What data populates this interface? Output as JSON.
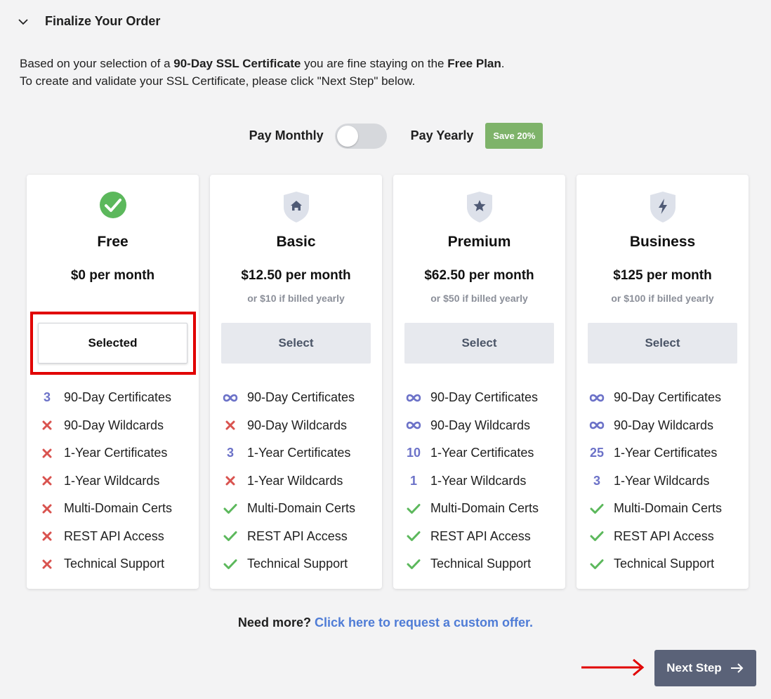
{
  "section": {
    "title": "Finalize Your Order",
    "collapse_icon": "chevron-down-icon"
  },
  "intro": {
    "line1_prefix": "Based on your selection of a ",
    "line1_cert": "90-Day SSL Certificate",
    "line1_mid": " you are fine staying on the ",
    "line1_plan": "Free Plan",
    "line1_suffix": ".",
    "line2": "To create and validate your SSL Certificate, please click \"Next Step\" below."
  },
  "billing": {
    "monthly_label": "Pay Monthly",
    "yearly_label": "Pay Yearly",
    "save_badge": "Save 20%",
    "toggle_state": "monthly"
  },
  "colors": {
    "check": "#5cb85c",
    "cross": "#d9534f",
    "count": "#6c72c8",
    "shield": "#dde1ea",
    "shield_glyph": "#4f5a75",
    "highlight": "#e10000",
    "link": "#4f7cd6",
    "next_button": "#5a6278"
  },
  "plans": [
    {
      "name": "Free",
      "price": "$0 per month",
      "yearly_note": "",
      "button": "Selected",
      "state": "selected",
      "icon": "check-circle-icon",
      "features": [
        {
          "mark": "count",
          "value": "3",
          "label": "90-Day Certificates"
        },
        {
          "mark": "cross",
          "value": "",
          "label": "90-Day Wildcards"
        },
        {
          "mark": "cross",
          "value": "",
          "label": "1-Year Certificates"
        },
        {
          "mark": "cross",
          "value": "",
          "label": "1-Year Wildcards"
        },
        {
          "mark": "cross",
          "value": "",
          "label": "Multi-Domain Certs"
        },
        {
          "mark": "cross",
          "value": "",
          "label": "REST API Access"
        },
        {
          "mark": "cross",
          "value": "",
          "label": "Technical Support"
        }
      ]
    },
    {
      "name": "Basic",
      "price": "$12.50 per month",
      "yearly_note": "or $10 if billed yearly",
      "button": "Select",
      "state": "select",
      "icon": "shield-home-icon",
      "features": [
        {
          "mark": "infinity",
          "value": "",
          "label": "90-Day Certificates"
        },
        {
          "mark": "cross",
          "value": "",
          "label": "90-Day Wildcards"
        },
        {
          "mark": "count",
          "value": "3",
          "label": "1-Year Certificates"
        },
        {
          "mark": "cross",
          "value": "",
          "label": "1-Year Wildcards"
        },
        {
          "mark": "check",
          "value": "",
          "label": "Multi-Domain Certs"
        },
        {
          "mark": "check",
          "value": "",
          "label": "REST API Access"
        },
        {
          "mark": "check",
          "value": "",
          "label": "Technical Support"
        }
      ]
    },
    {
      "name": "Premium",
      "price": "$62.50 per month",
      "yearly_note": "or $50 if billed yearly",
      "button": "Select",
      "state": "select",
      "icon": "shield-star-icon",
      "features": [
        {
          "mark": "infinity",
          "value": "",
          "label": "90-Day Certificates"
        },
        {
          "mark": "infinity",
          "value": "",
          "label": "90-Day Wildcards"
        },
        {
          "mark": "count",
          "value": "10",
          "label": "1-Year Certificates"
        },
        {
          "mark": "count",
          "value": "1",
          "label": "1-Year Wildcards"
        },
        {
          "mark": "check",
          "value": "",
          "label": "Multi-Domain Certs"
        },
        {
          "mark": "check",
          "value": "",
          "label": "REST API Access"
        },
        {
          "mark": "check",
          "value": "",
          "label": "Technical Support"
        }
      ]
    },
    {
      "name": "Business",
      "price": "$125 per month",
      "yearly_note": "or $100 if billed yearly",
      "button": "Select",
      "state": "select",
      "icon": "shield-bolt-icon",
      "features": [
        {
          "mark": "infinity",
          "value": "",
          "label": "90-Day Certificates"
        },
        {
          "mark": "infinity",
          "value": "",
          "label": "90-Day Wildcards"
        },
        {
          "mark": "count",
          "value": "25",
          "label": "1-Year Certificates"
        },
        {
          "mark": "count",
          "value": "3",
          "label": "1-Year Wildcards"
        },
        {
          "mark": "check",
          "value": "",
          "label": "Multi-Domain Certs"
        },
        {
          "mark": "check",
          "value": "",
          "label": "REST API Access"
        },
        {
          "mark": "check",
          "value": "",
          "label": "Technical Support"
        }
      ]
    }
  ],
  "footer": {
    "need_more": "Need more?",
    "custom_offer_link": "Click here to request a custom offer.",
    "next_step": "Next Step",
    "next_icon": "arrow-right-icon"
  }
}
